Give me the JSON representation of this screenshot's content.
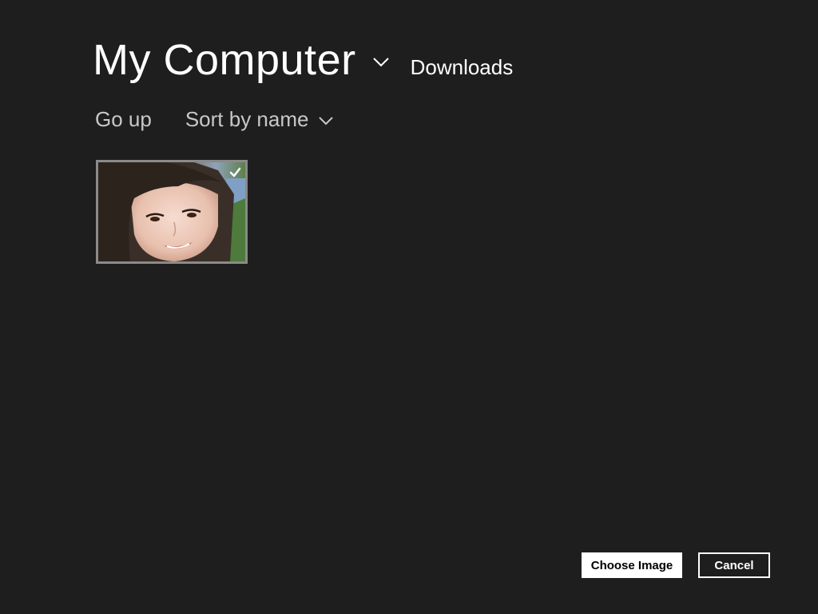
{
  "header": {
    "location": "My Computer",
    "location_chevron_icon": "chevron-down-icon",
    "subfolder": "Downloads"
  },
  "toolbar": {
    "go_up_label": "Go up",
    "sort_label": "Sort by name",
    "sort_chevron_icon": "chevron-down-icon"
  },
  "files": [
    {
      "type": "image",
      "selected": true,
      "check_icon": "checkmark-icon"
    }
  ],
  "actions": {
    "choose_label": "Choose Image",
    "cancel_label": "Cancel"
  },
  "colors": {
    "background": "#1e1e1e",
    "text": "#ffffff",
    "muted_text": "#c8c8c8",
    "selection_border": "#8a8a8a"
  }
}
